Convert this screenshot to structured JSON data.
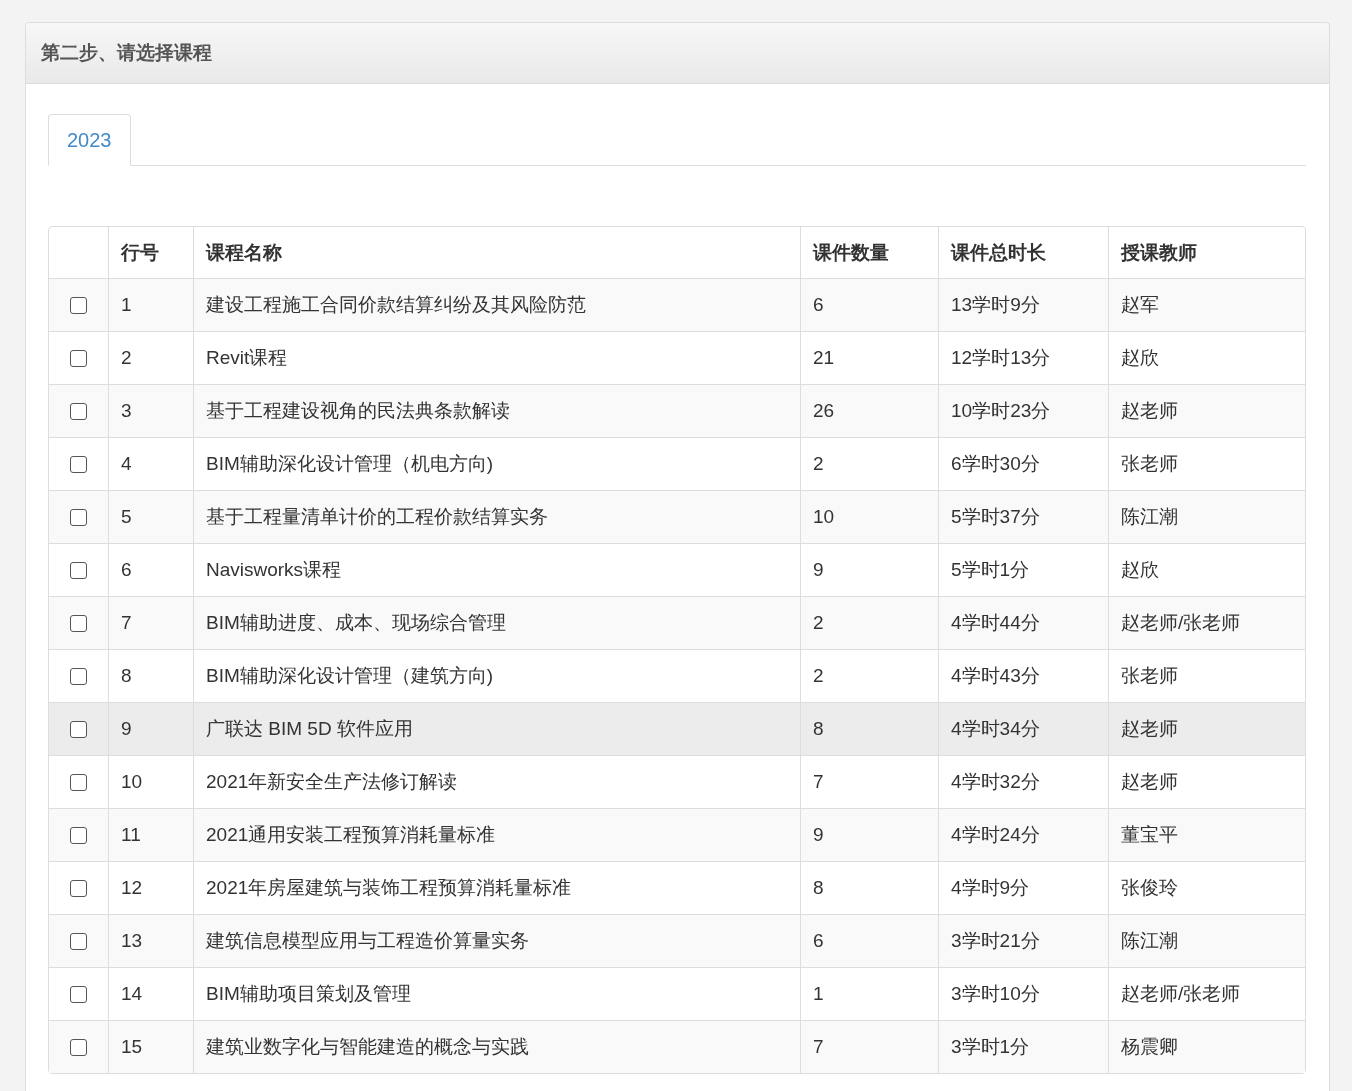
{
  "panel": {
    "title": "第二步、请选择课程"
  },
  "tabs": [
    {
      "label": "2023",
      "selected": true
    }
  ],
  "table": {
    "columns": [
      "行号",
      "课程名称",
      "课件数量",
      "课件总时长",
      "授课教师"
    ],
    "rows": [
      {
        "checked": false,
        "hovered": false,
        "cells": [
          "1",
          "建设工程施工合同价款结算纠纷及其风险防范",
          "6",
          "13学时9分",
          "赵军"
        ]
      },
      {
        "checked": false,
        "hovered": false,
        "cells": [
          "2",
          "Revit课程",
          "21",
          "12学时13分",
          "赵欣"
        ]
      },
      {
        "checked": false,
        "hovered": false,
        "cells": [
          "3",
          "基于工程建设视角的民法典条款解读",
          "26",
          "10学时23分",
          "赵老师"
        ]
      },
      {
        "checked": false,
        "hovered": false,
        "cells": [
          "4",
          "BIM辅助深化设计管理（机电方向)",
          "2",
          "6学时30分",
          "张老师"
        ]
      },
      {
        "checked": false,
        "hovered": false,
        "cells": [
          "5",
          "基于工程量清单计价的工程价款结算实务",
          "10",
          "5学时37分",
          "陈江潮"
        ]
      },
      {
        "checked": false,
        "hovered": false,
        "cells": [
          "6",
          "Navisworks课程",
          "9",
          "5学时1分",
          "赵欣"
        ]
      },
      {
        "checked": false,
        "hovered": false,
        "cells": [
          "7",
          "BIM辅助进度、成本、现场综合管理",
          "2",
          "4学时44分",
          "赵老师/张老师"
        ]
      },
      {
        "checked": false,
        "hovered": false,
        "cells": [
          "8",
          "BIM辅助深化设计管理（建筑方向)",
          "2",
          "4学时43分",
          "张老师"
        ]
      },
      {
        "checked": false,
        "hovered": true,
        "cells": [
          "9",
          "广联达 BIM 5D 软件应用",
          "8",
          "4学时34分",
          "赵老师"
        ]
      },
      {
        "checked": false,
        "hovered": false,
        "cells": [
          "10",
          "2021年新安全生产法修订解读",
          "7",
          "4学时32分",
          "赵老师"
        ]
      },
      {
        "checked": false,
        "hovered": false,
        "cells": [
          "11",
          "2021通用安装工程预算消耗量标准",
          "9",
          "4学时24分",
          "董宝平"
        ]
      },
      {
        "checked": false,
        "hovered": false,
        "cells": [
          "12",
          "2021年房屋建筑与装饰工程预算消耗量标准",
          "8",
          "4学时9分",
          "张俊玲"
        ]
      },
      {
        "checked": false,
        "hovered": false,
        "cells": [
          "13",
          "建筑信息模型应用与工程造价算量实务",
          "6",
          "3学时21分",
          "陈江潮"
        ]
      },
      {
        "checked": false,
        "hovered": false,
        "cells": [
          "14",
          "BIM辅助项目策划及管理",
          "1",
          "3学时10分",
          "赵老师/张老师"
        ]
      },
      {
        "checked": false,
        "hovered": false,
        "cells": [
          "15",
          "建筑业数字化与智能建造的概念与实践",
          "7",
          "3学时1分",
          "杨震卿"
        ]
      }
    ]
  }
}
